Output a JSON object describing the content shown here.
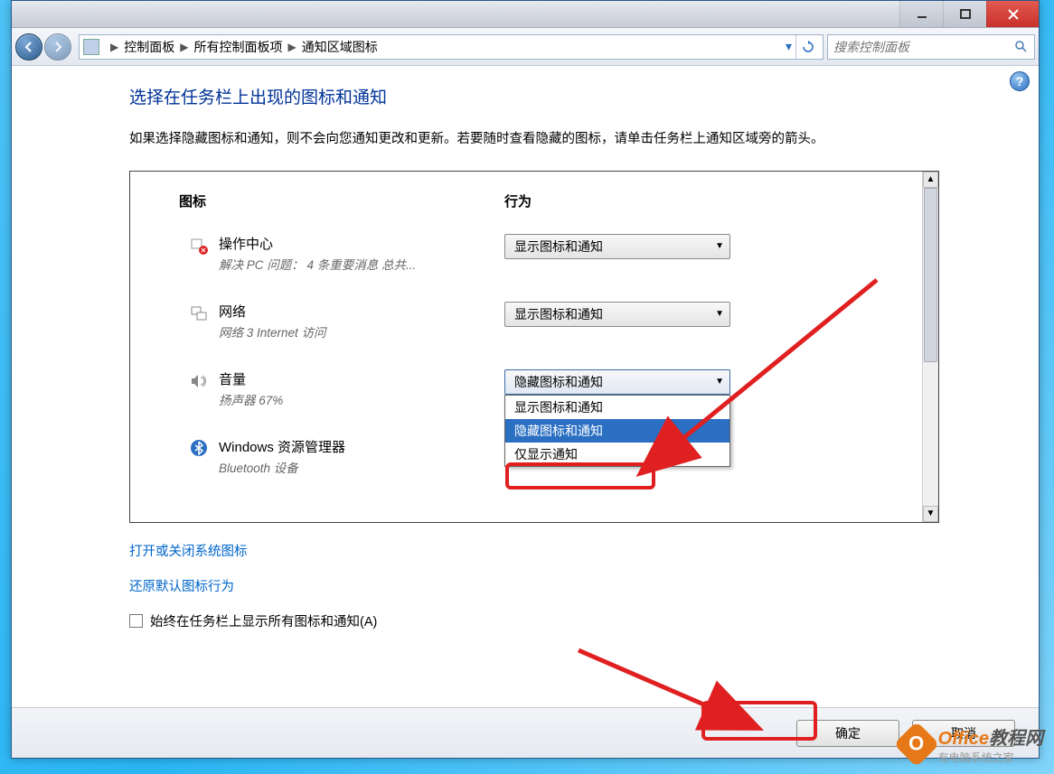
{
  "breadcrumb": {
    "items": [
      "控制面板",
      "所有控制面板项",
      "通知区域图标"
    ]
  },
  "search": {
    "placeholder": "搜索控制面板"
  },
  "page": {
    "heading": "选择在任务栏上出现的图标和通知",
    "description": "如果选择隐藏图标和通知，则不会向您通知更改和更新。若要随时查看隐藏的图标，请单击任务栏上通知区域旁的箭头。"
  },
  "columns": {
    "icons": "图标",
    "behaviors": "行为"
  },
  "rows": [
    {
      "title": "操作中心",
      "sub": "解决 PC 问题： 4 条重要消息  总共...",
      "selected": "显示图标和通知"
    },
    {
      "title": "网络",
      "sub": "网络 3 Internet 访问",
      "selected": "显示图标和通知"
    },
    {
      "title": "音量",
      "sub": "扬声器 67%",
      "selected": "隐藏图标和通知"
    },
    {
      "title": "Windows 资源管理器",
      "sub": "Bluetooth 设备",
      "selected": ""
    }
  ],
  "dropdown_options": [
    "显示图标和通知",
    "隐藏图标和通知",
    "仅显示通知"
  ],
  "links": {
    "toggle_system": "打开或关闭系统图标",
    "restore_defaults": "还原默认图标行为"
  },
  "checkbox": {
    "label": "始终在任务栏上显示所有图标和通知(A)"
  },
  "buttons": {
    "ok": "确定",
    "cancel": "取消"
  },
  "watermark": {
    "brand": "Office",
    "suffix": "教程网",
    "tagline": "有电脑系统之家"
  }
}
